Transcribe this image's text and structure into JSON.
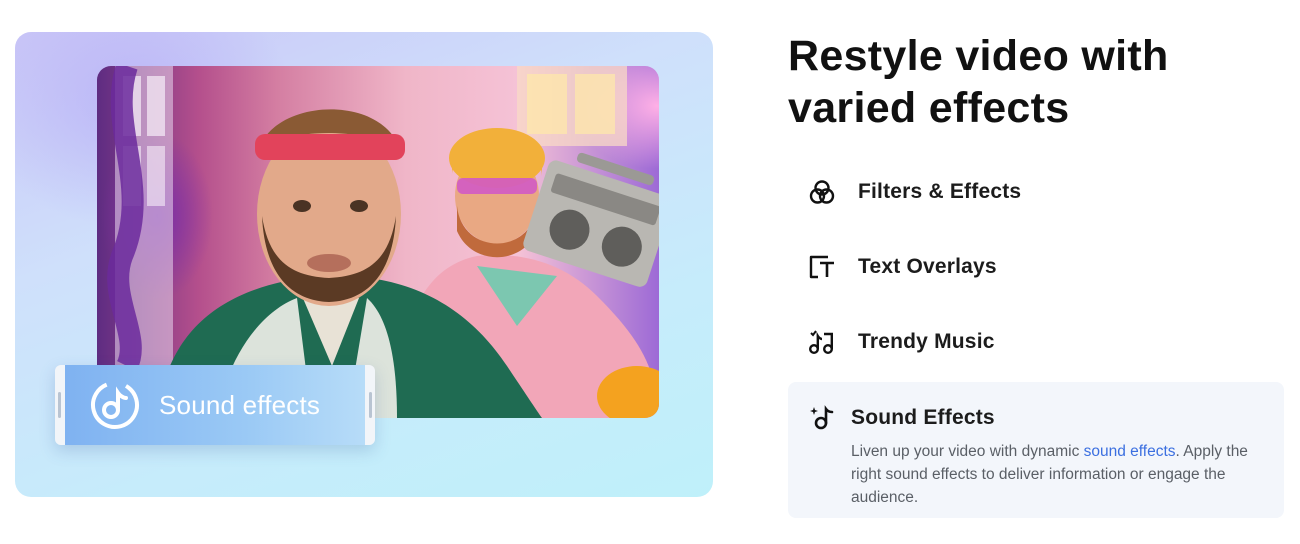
{
  "headline": "Restyle video with varied effects",
  "showcase": {
    "chip_label": "Sound effects",
    "chip_icon": "music-note-circle-icon"
  },
  "features": [
    {
      "label": "Filters & Effects",
      "icon": "filters-icon"
    },
    {
      "label": "Text Overlays",
      "icon": "text-overlay-icon"
    },
    {
      "label": "Trendy Music",
      "icon": "music-notes-icon"
    },
    {
      "label": "Sound Effects",
      "icon": "sound-effect-icon",
      "active": true,
      "desc_before": "Liven up your video with dynamic ",
      "desc_link": "sound effects",
      "desc_after": ". Apply the right sound effects to deliver information or engage the audience."
    }
  ],
  "colors": {
    "link": "#3b6fe0",
    "active_bg": "#f3f6fb",
    "chip": "#8ebff3"
  }
}
